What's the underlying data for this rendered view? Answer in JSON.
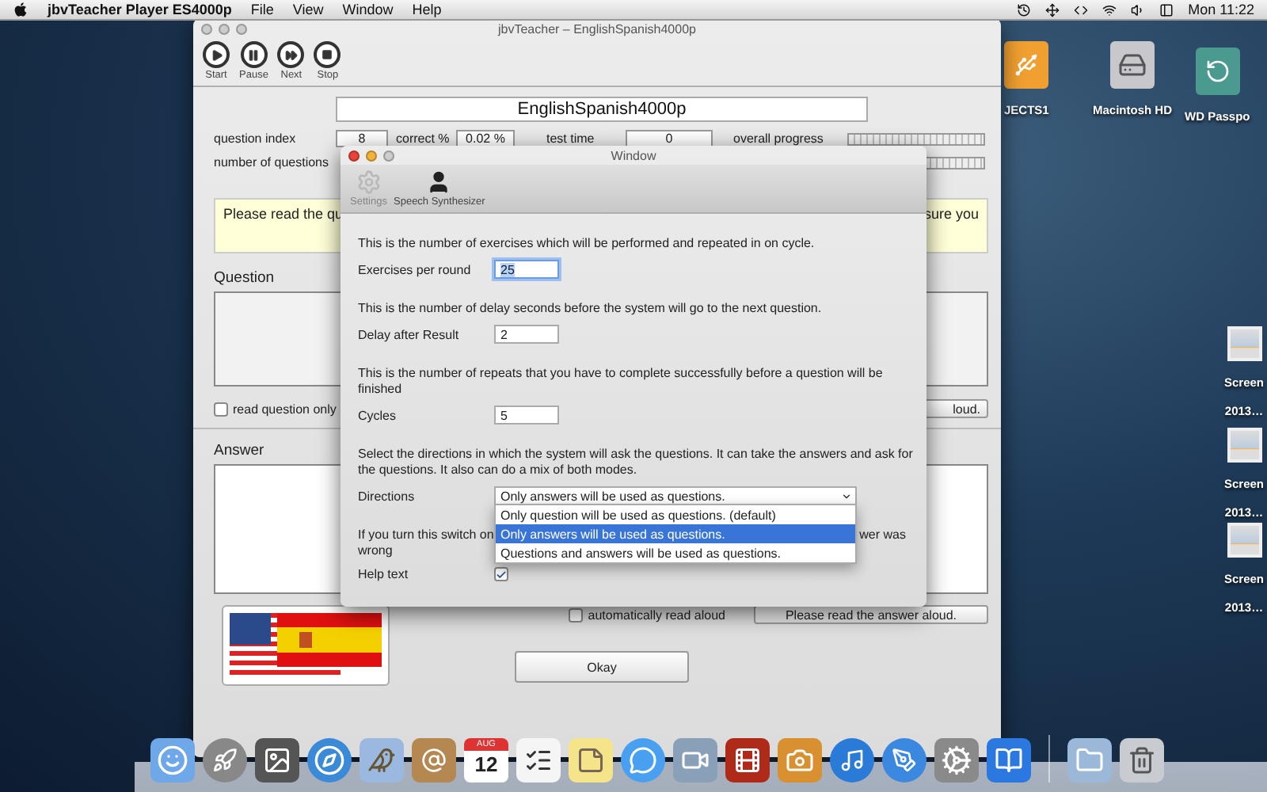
{
  "menu_bar": {
    "app_name": "jbvTeacher Player ES4000p",
    "menus": [
      "File",
      "View",
      "Window",
      "Help"
    ],
    "clock": "Mon 11:22"
  },
  "desktop_icons": [
    {
      "kind": "usb",
      "lines": [
        "JECTS1"
      ]
    },
    {
      "kind": "disk",
      "lines": [
        "Macintosh HD"
      ]
    },
    {
      "kind": "backup",
      "lines": [
        "WD Passpo"
      ]
    },
    {
      "kind": "screenshot",
      "lines": [
        "Screen",
        "2013…"
      ]
    },
    {
      "kind": "screenshot",
      "lines": [
        "Screen",
        "2013…"
      ]
    },
    {
      "kind": "screenshot",
      "lines": [
        "Screen",
        "2013…"
      ]
    }
  ],
  "main_window": {
    "title": "jbvTeacher – EnglishSpanish4000p",
    "toolbar": [
      {
        "kind": "start",
        "label": "Start"
      },
      {
        "kind": "pause",
        "label": "Pause"
      },
      {
        "kind": "next",
        "label": "Next"
      },
      {
        "kind": "stop",
        "label": "Stop"
      }
    ],
    "deck_title": "EnglishSpanish4000p",
    "question_index": {
      "label": "question index",
      "value": "8"
    },
    "correct": {
      "label": "correct %",
      "value": "0.02 %"
    },
    "test_time": {
      "label": "test time",
      "value": "0"
    },
    "overall_progress": {
      "label": "overall progress",
      "level": 0
    },
    "number_of_questions": {
      "label": "number of questions",
      "level": 0
    },
    "help_text": [
      "Please read the qu",
      "sure you"
    ],
    "question_label": "Question",
    "read_question_only": {
      "label": "read question only",
      "checked": false
    },
    "question_button": "loud.",
    "answer_label": "Answer",
    "auto_read": {
      "label": "automatically read aloud",
      "checked": false
    },
    "answer_button": "Please read the answer aloud.",
    "okay_button": "Okay"
  },
  "dialog": {
    "title": "Window",
    "toolbar": [
      {
        "kind": "gear",
        "label": "Settings",
        "disabled": true
      },
      {
        "kind": "person",
        "label": "Speech Synthesizer",
        "disabled": false
      }
    ],
    "settings": [
      {
        "kind": "field",
        "description": "This is the number of exercises which will be performed and repeated in on cycle.",
        "label": "Exercises per round",
        "value": "25",
        "focused": true
      },
      {
        "kind": "field",
        "description": "This is the number of delay seconds before the system will go to the next question.",
        "label": "Delay after Result",
        "value": "2",
        "focused": false
      },
      {
        "kind": "field",
        "description": "This is the number of repeats that you have to complete successfully before a question will be finished",
        "label": "Cycles",
        "value": "5",
        "focused": false
      },
      {
        "kind": "select",
        "description": "Select the directions in which the system will ask the questions. It can take the answers and ask for the questions. It also can do a mix of both modes.",
        "label": "Directions",
        "value": "Only answers will be used as questions.",
        "options": [
          {
            "label": "Only question will be used as questions. (default)",
            "selected": false
          },
          {
            "label": "Only answers will be used as questions.",
            "selected": true
          },
          {
            "label": "Questions and answers will be used as questions.",
            "selected": false
          }
        ]
      },
      {
        "kind": "checkbox",
        "description_parts": [
          "If you turn this switch on",
          "wer was",
          "wrong"
        ],
        "label": "Help text",
        "checked": true
      }
    ]
  },
  "dock": {
    "calendar_month": "AUG",
    "calendar_day": "12"
  }
}
